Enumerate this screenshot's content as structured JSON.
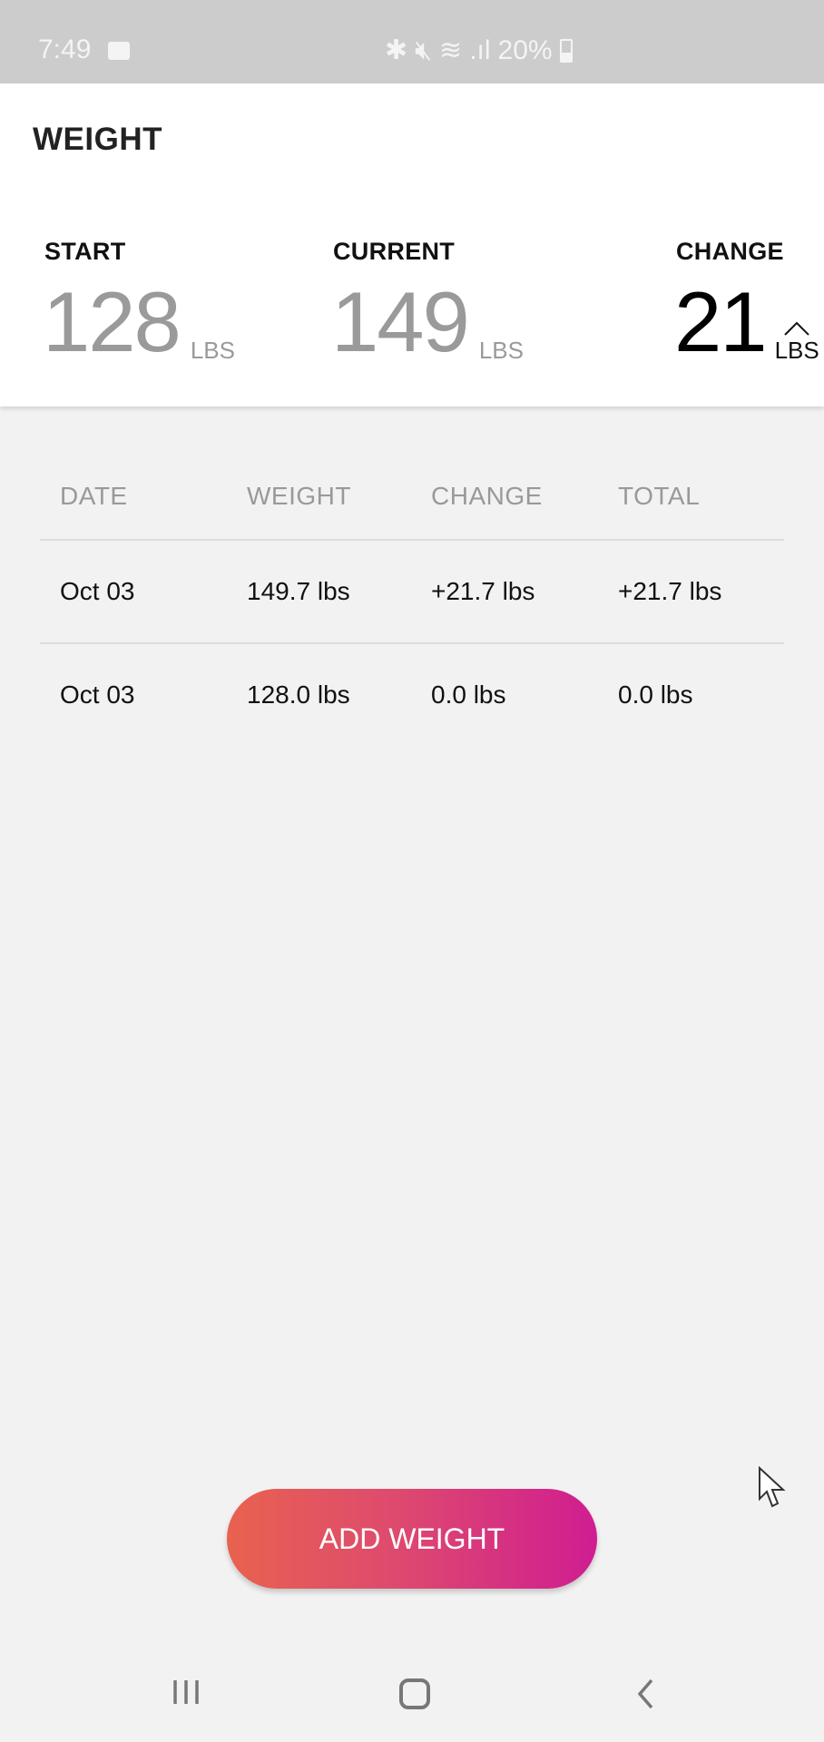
{
  "status_bar": {
    "time": "7:49",
    "battery": "20%",
    "icons": [
      "video-camera-icon",
      "bluetooth-icon",
      "mute-icon",
      "wifi-icon",
      "signal-icon",
      "battery-icon"
    ]
  },
  "header": {
    "title": "WEIGHT"
  },
  "stats": {
    "start": {
      "label": "START",
      "value": "128",
      "unit": "LBS"
    },
    "current": {
      "label": "CURRENT",
      "value": "149",
      "unit": "LBS"
    },
    "change": {
      "label": "CHANGE",
      "value": "21",
      "unit": "LBS",
      "direction": "up"
    }
  },
  "table": {
    "columns": [
      "DATE",
      "WEIGHT",
      "CHANGE",
      "TOTAL"
    ],
    "rows": [
      [
        "Oct 03",
        "149.7 lbs",
        "+21.7 lbs",
        "+21.7 lbs"
      ],
      [
        "Oct 03",
        "128.0 lbs",
        "0.0 lbs",
        "0.0 lbs"
      ]
    ]
  },
  "actions": {
    "add_weight_label": "ADD WEIGHT"
  },
  "colors": {
    "button_gradient_start": "#e8624f",
    "button_gradient_end": "#cf1d91",
    "status_bar_bg": "#cccccc",
    "page_bg": "#f2f2f2"
  }
}
